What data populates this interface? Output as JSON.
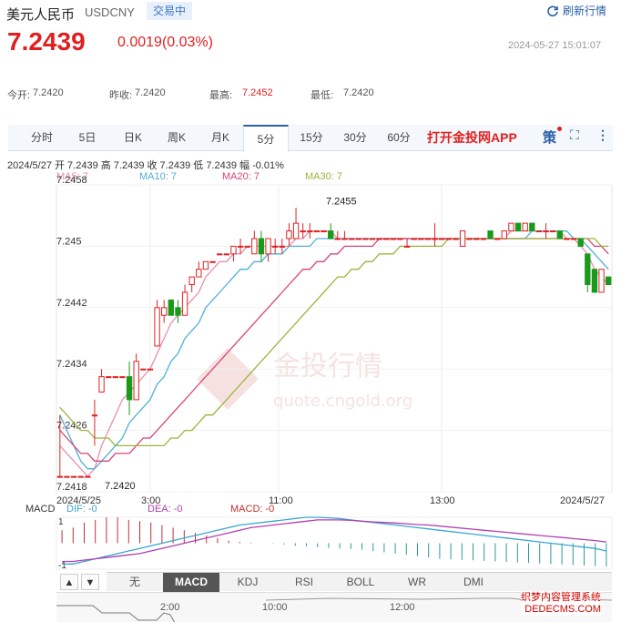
{
  "header": {
    "title": "美元人民币",
    "code": "USDCNY",
    "status_badge": "交易中",
    "refresh_label": "刷新行情",
    "price": "7.2439",
    "change": "0.0019(0.03%)",
    "timestamp": "2024-05-27 15:01:07"
  },
  "stats": {
    "open_label": "今开:",
    "open": "7.2420",
    "prev_label": "昨收:",
    "prev": "7.2420",
    "high_label": "最高:",
    "high": "7.2452",
    "low_label": "最低:",
    "low": "7.2420"
  },
  "tabs": [
    "分时",
    "5日",
    "日K",
    "周K",
    "月K",
    "5分",
    "15分",
    "30分",
    "60分"
  ],
  "active_tab": "5分",
  "app_label": "打开金投网APP",
  "ohlc_line": "2024/5/27  开 7.2439  高 7.2439  收 7.2439  低 7.2439  幅 -0.01%",
  "ma_legend": [
    {
      "label": "MA5: 7",
      "color": "#e88fb0"
    },
    {
      "label": "MA10: 7",
      "color": "#4fb0d8"
    },
    {
      "label": "MA20: 7",
      "color": "#d8437a"
    },
    {
      "label": "MA30: 7",
      "color": "#9ab43a"
    }
  ],
  "macd_legend": [
    {
      "label": "MACD",
      "color": "#333"
    },
    {
      "label": "DIF: -0",
      "color": "#3aa7d0"
    },
    {
      "label": "DEA: -0",
      "color": "#b040b0"
    },
    {
      "label": "MACD: -0",
      "color": "#c03030"
    }
  ],
  "macd_axis": {
    "top": "1",
    "bottom": "-1"
  },
  "indicator_buttons": [
    "无",
    "MACD",
    "KDJ",
    "RSI",
    "BOLL",
    "WR",
    "DMI"
  ],
  "active_indicator": "MACD",
  "nav_labels": [
    "2:00",
    "10:00",
    "12:00"
  ],
  "watermark": {
    "cn": "金投行情",
    "url": "quote.cngold.org"
  },
  "corner_watermark": [
    "织梦内容管理系统",
    "DEDECMS.COM"
  ],
  "chart_data": {
    "type": "candlestick",
    "x_tick_labels": [
      "2024/5/25",
      "3:00",
      "11:00",
      "13:00",
      "2024/5/27"
    ],
    "y_ticks": [
      7.2458,
      7.245,
      7.2442,
      7.2434,
      7.2426,
      7.2418
    ],
    "y_tick_labels": [
      "7.2458",
      "7.245",
      "7.2442",
      "7.2434",
      "7.2426",
      "7.2418"
    ],
    "ylim": [
      7.2418,
      7.2458
    ],
    "annotations": [
      {
        "text": "7.2455",
        "value": 7.2455
      },
      {
        "text": "7.2420",
        "value": 7.242
      }
    ],
    "candles": [
      [
        7.242,
        7.2428,
        7.242,
        7.242
      ],
      [
        7.242,
        7.242,
        7.242,
        7.242
      ],
      [
        7.242,
        7.242,
        7.242,
        7.242
      ],
      [
        7.242,
        7.242,
        7.242,
        7.242
      ],
      [
        7.242,
        7.242,
        7.242,
        7.242
      ],
      [
        7.2428,
        7.243,
        7.2424,
        7.2428
      ],
      [
        7.2431,
        7.2434,
        7.2431,
        7.2433
      ],
      [
        7.2433,
        7.2433,
        7.2433,
        7.2433
      ],
      [
        7.2433,
        7.2433,
        7.2433,
        7.2433
      ],
      [
        7.2433,
        7.2433,
        7.2433,
        7.2433
      ],
      [
        7.2433,
        7.2435,
        7.2428,
        7.243
      ],
      [
        7.243,
        7.2436,
        7.243,
        7.2435
      ],
      [
        7.2434,
        7.2434,
        7.2434,
        7.2434
      ],
      [
        7.2434,
        7.2434,
        7.2434,
        7.2434
      ],
      [
        7.2437,
        7.2443,
        7.2437,
        7.2442
      ],
      [
        7.2441,
        7.2443,
        7.244,
        7.2442
      ],
      [
        7.2443,
        7.2443,
        7.2441,
        7.2441
      ],
      [
        7.2442,
        7.2443,
        7.244,
        7.2441
      ],
      [
        7.2441,
        7.2445,
        7.2441,
        7.2444
      ],
      [
        7.2445,
        7.2446,
        7.2444,
        7.2446
      ],
      [
        7.2446,
        7.2448,
        7.2446,
        7.2447
      ],
      [
        7.2447,
        7.2448,
        7.2447,
        7.2448
      ],
      [
        7.2448,
        7.2448,
        7.2448,
        7.2448
      ],
      [
        7.2449,
        7.2449,
        7.2449,
        7.2449
      ],
      [
        7.2449,
        7.2449,
        7.2449,
        7.2449
      ],
      [
        7.2449,
        7.245,
        7.2448,
        7.245
      ],
      [
        7.245,
        7.2451,
        7.2449,
        7.245
      ],
      [
        7.245,
        7.245,
        7.245,
        7.245
      ],
      [
        7.2449,
        7.2452,
        7.2449,
        7.2451
      ],
      [
        7.2451,
        7.2452,
        7.2448,
        7.2449
      ],
      [
        7.2449,
        7.2451,
        7.2448,
        7.2451
      ],
      [
        7.245,
        7.2451,
        7.2449,
        7.245
      ],
      [
        7.245,
        7.2451,
        7.2449,
        7.245
      ],
      [
        7.2451,
        7.2453,
        7.245,
        7.2452
      ],
      [
        7.2451,
        7.2455,
        7.2451,
        7.2453
      ],
      [
        7.2452,
        7.2453,
        7.2451,
        7.2452
      ],
      [
        7.2452,
        7.2453,
        7.2451,
        7.2452
      ],
      [
        7.2452,
        7.2452,
        7.2452,
        7.2452
      ],
      [
        7.2452,
        7.2452,
        7.2452,
        7.2452
      ],
      [
        7.2452,
        7.2453,
        7.2451,
        7.2451
      ],
      [
        7.2451,
        7.2452,
        7.2451,
        7.2451
      ],
      [
        7.2451,
        7.2452,
        7.2451,
        7.2451
      ],
      [
        7.2451,
        7.2451,
        7.2451,
        7.2451
      ],
      [
        7.2451,
        7.2451,
        7.2451,
        7.2451
      ],
      [
        7.2451,
        7.2451,
        7.2451,
        7.2451
      ],
      [
        7.2451,
        7.2451,
        7.2451,
        7.2451
      ],
      [
        7.2451,
        7.2451,
        7.2451,
        7.2451
      ],
      [
        7.2451,
        7.2451,
        7.2451,
        7.2451
      ],
      [
        7.2451,
        7.2451,
        7.2451,
        7.2451
      ],
      [
        7.2451,
        7.2451,
        7.2451,
        7.2451
      ],
      [
        7.245,
        7.2451,
        7.245,
        7.245
      ],
      [
        7.2451,
        7.2451,
        7.2451,
        7.2451
      ],
      [
        7.2451,
        7.2451,
        7.2451,
        7.2451
      ],
      [
        7.2451,
        7.2451,
        7.2451,
        7.2451
      ],
      [
        7.2451,
        7.2453,
        7.245,
        7.2451
      ],
      [
        7.2451,
        7.2451,
        7.2451,
        7.2451
      ],
      [
        7.2451,
        7.2451,
        7.2451,
        7.2451
      ],
      [
        7.2451,
        7.2451,
        7.2451,
        7.2451
      ],
      [
        7.245,
        7.2452,
        7.245,
        7.2452
      ],
      [
        7.2451,
        7.2451,
        7.2451,
        7.2451
      ],
      [
        7.2451,
        7.2451,
        7.2451,
        7.2451
      ],
      [
        7.2451,
        7.2451,
        7.2451,
        7.2451
      ],
      [
        7.2452,
        7.2452,
        7.2451,
        7.2451
      ],
      [
        7.2451,
        7.2451,
        7.2451,
        7.2451
      ],
      [
        7.2451,
        7.2452,
        7.2451,
        7.2452
      ],
      [
        7.2452,
        7.2453,
        7.2452,
        7.2453
      ],
      [
        7.2453,
        7.2453,
        7.2452,
        7.2452
      ],
      [
        7.2452,
        7.2453,
        7.2452,
        7.2453
      ],
      [
        7.2453,
        7.2453,
        7.2452,
        7.2452
      ],
      [
        7.2452,
        7.2452,
        7.2452,
        7.2452
      ],
      [
        7.2452,
        7.2453,
        7.2451,
        7.2452
      ],
      [
        7.2452,
        7.2452,
        7.2452,
        7.2452
      ],
      [
        7.2452,
        7.2452,
        7.2451,
        7.2451
      ],
      [
        7.2451,
        7.2451,
        7.2451,
        7.2451
      ],
      [
        7.2451,
        7.2451,
        7.2451,
        7.2451
      ],
      [
        7.2451,
        7.2451,
        7.245,
        7.245
      ],
      [
        7.2449,
        7.2449,
        7.2444,
        7.2445
      ],
      [
        7.2447,
        7.2447,
        7.2444,
        7.2444
      ],
      [
        7.2444,
        7.2447,
        7.2444,
        7.2447
      ],
      [
        7.2446,
        7.2446,
        7.2445,
        7.2445
      ]
    ],
    "ma_series": [
      {
        "name": "MA5",
        "color": "#e88fb0",
        "values": [
          7.2424,
          7.2423,
          7.2422,
          7.2421,
          7.242,
          7.2421,
          7.2424,
          7.2426,
          7.2428,
          7.243,
          7.2431,
          7.2432,
          7.2433,
          7.2434,
          7.2436,
          7.2438,
          7.244,
          7.2441,
          7.2442,
          7.2443,
          7.2444,
          7.2446,
          7.2447,
          7.2448,
          7.2448,
          7.2449,
          7.2449,
          7.245,
          7.245,
          7.245,
          7.245,
          7.245,
          7.245,
          7.245,
          7.2451,
          7.2451,
          7.2452,
          7.2452,
          7.2452,
          7.2452,
          7.2451,
          7.2451,
          7.2451,
          7.2451,
          7.2451,
          7.2451,
          7.2451,
          7.2451,
          7.2451,
          7.2451,
          7.2451,
          7.2451,
          7.2451,
          7.2451,
          7.2451,
          7.2451,
          7.2451,
          7.2451,
          7.2451,
          7.2451,
          7.2451,
          7.2451,
          7.2451,
          7.2451,
          7.2451,
          7.2452,
          7.2452,
          7.2452,
          7.2452,
          7.2452,
          7.2452,
          7.2452,
          7.2452,
          7.2451,
          7.2451,
          7.245,
          7.2449,
          7.2447,
          7.2446,
          7.2445
        ]
      },
      {
        "name": "MA10",
        "color": "#4fb0d8",
        "values": [
          7.2428,
          7.2426,
          7.2424,
          7.2422,
          7.2421,
          7.2421,
          7.2422,
          7.2423,
          7.2424,
          7.2425,
          7.2427,
          7.2428,
          7.2429,
          7.243,
          7.2432,
          7.2433,
          7.2435,
          7.2436,
          7.2438,
          7.2439,
          7.244,
          7.2442,
          7.2443,
          7.2444,
          7.2445,
          7.2446,
          7.2447,
          7.2447,
          7.2448,
          7.2448,
          7.2449,
          7.2449,
          7.2449,
          7.245,
          7.245,
          7.245,
          7.245,
          7.2451,
          7.2451,
          7.2451,
          7.2451,
          7.2451,
          7.2451,
          7.2451,
          7.2451,
          7.2451,
          7.2451,
          7.2451,
          7.2451,
          7.2451,
          7.2451,
          7.2451,
          7.2451,
          7.2451,
          7.2451,
          7.2451,
          7.2451,
          7.2451,
          7.2451,
          7.2451,
          7.2451,
          7.2451,
          7.2451,
          7.2451,
          7.2451,
          7.2451,
          7.2451,
          7.2451,
          7.2452,
          7.2452,
          7.2452,
          7.2452,
          7.2452,
          7.2452,
          7.2451,
          7.2451,
          7.245,
          7.2449,
          7.2448,
          7.2447
        ]
      },
      {
        "name": "MA20",
        "color": "#d8437a",
        "values": [
          7.2426,
          7.2425,
          7.2424,
          7.2423,
          7.2423,
          7.2422,
          7.2422,
          7.2422,
          7.2423,
          7.2423,
          7.2423,
          7.2424,
          7.2425,
          7.2425,
          7.2426,
          7.2427,
          7.2428,
          7.2429,
          7.243,
          7.2431,
          7.2432,
          7.2433,
          7.2434,
          7.2435,
          7.2436,
          7.2437,
          7.2438,
          7.2439,
          7.244,
          7.2441,
          7.2442,
          7.2443,
          7.2444,
          7.2445,
          7.2446,
          7.2447,
          7.2447,
          7.2448,
          7.2448,
          7.2449,
          7.2449,
          7.245,
          7.245,
          7.245,
          7.245,
          7.245,
          7.2451,
          7.2451,
          7.2451,
          7.2451,
          7.2451,
          7.2451,
          7.2451,
          7.2451,
          7.2451,
          7.2451,
          7.2451,
          7.2451,
          7.2451,
          7.2451,
          7.2451,
          7.2451,
          7.2451,
          7.2451,
          7.2451,
          7.2451,
          7.2451,
          7.2451,
          7.2451,
          7.2451,
          7.2451,
          7.2451,
          7.2451,
          7.2451,
          7.2451,
          7.2451,
          7.2451,
          7.245,
          7.245,
          7.2449
        ]
      },
      {
        "name": "MA30",
        "color": "#9ab43a",
        "values": [
          7.2429,
          7.2428,
          7.2427,
          7.2426,
          7.2426,
          7.2425,
          7.2425,
          7.2425,
          7.2424,
          7.2424,
          7.2424,
          7.2424,
          7.2424,
          7.2424,
          7.2424,
          7.2424,
          7.2425,
          7.2425,
          7.2426,
          7.2426,
          7.2427,
          7.2428,
          7.2428,
          7.2429,
          7.243,
          7.2431,
          7.2432,
          7.2433,
          7.2434,
          7.2435,
          7.2436,
          7.2437,
          7.2438,
          7.2439,
          7.244,
          7.2441,
          7.2442,
          7.2443,
          7.2444,
          7.2445,
          7.2446,
          7.2446,
          7.2447,
          7.2447,
          7.2448,
          7.2448,
          7.2449,
          7.2449,
          7.2449,
          7.245,
          7.245,
          7.245,
          7.245,
          7.245,
          7.245,
          7.245,
          7.2451,
          7.2451,
          7.2451,
          7.2451,
          7.2451,
          7.2451,
          7.2451,
          7.2451,
          7.2451,
          7.2451,
          7.2451,
          7.2451,
          7.2451,
          7.2451,
          7.2451,
          7.2451,
          7.2451,
          7.2451,
          7.2451,
          7.2451,
          7.2451,
          7.2451,
          7.245,
          7.245
        ]
      }
    ],
    "macd": {
      "ylim": [
        -1,
        1
      ],
      "dif": [
        -0.8,
        -0.8,
        -0.7,
        -0.6,
        -0.5,
        -0.4,
        -0.3,
        -0.2,
        -0.1,
        0,
        0.1,
        0.2,
        0.3,
        0.4,
        0.5,
        0.6,
        0.7,
        0.75,
        0.8,
        0.85,
        0.9,
        0.95,
        1.0,
        1.0,
        0.98,
        0.95,
        0.9,
        0.85,
        0.8,
        0.75,
        0.7,
        0.65,
        0.6,
        0.55,
        0.5,
        0.45,
        0.4,
        0.35,
        0.3,
        0.25,
        0.2,
        0.15,
        0.1,
        0.05,
        0,
        -0.05,
        -0.1,
        -0.15,
        -0.2,
        -0.3
      ],
      "dea": [
        -0.7,
        -0.7,
        -0.65,
        -0.6,
        -0.55,
        -0.5,
        -0.45,
        -0.4,
        -0.3,
        -0.2,
        -0.1,
        0,
        0.1,
        0.2,
        0.3,
        0.4,
        0.5,
        0.6,
        0.65,
        0.7,
        0.75,
        0.8,
        0.85,
        0.9,
        0.9,
        0.9,
        0.88,
        0.85,
        0.82,
        0.8,
        0.78,
        0.75,
        0.72,
        0.7,
        0.66,
        0.62,
        0.58,
        0.54,
        0.5,
        0.46,
        0.42,
        0.38,
        0.34,
        0.3,
        0.26,
        0.22,
        0.18,
        0.14,
        0.1,
        0.05
      ],
      "hist": [
        0.5,
        0.6,
        0.8,
        0.9,
        1.0,
        1.0,
        0.9,
        0.85,
        0.8,
        0.7,
        0.6,
        0.5,
        0.4,
        0.3,
        0.2,
        0.1,
        0.05,
        0.02,
        0,
        -0.02,
        -0.05,
        -0.1,
        -0.12,
        -0.15,
        -0.18,
        -0.2,
        -0.22,
        -0.25,
        -0.3,
        -0.35,
        -0.4,
        -0.45,
        -0.5,
        -0.55,
        -0.6,
        -0.62,
        -0.64,
        -0.66,
        -0.68,
        -0.7,
        -0.72,
        -0.74,
        -0.76,
        -0.78,
        -0.8,
        -0.82,
        -0.84,
        -0.86,
        -0.88,
        -0.9
      ]
    }
  }
}
